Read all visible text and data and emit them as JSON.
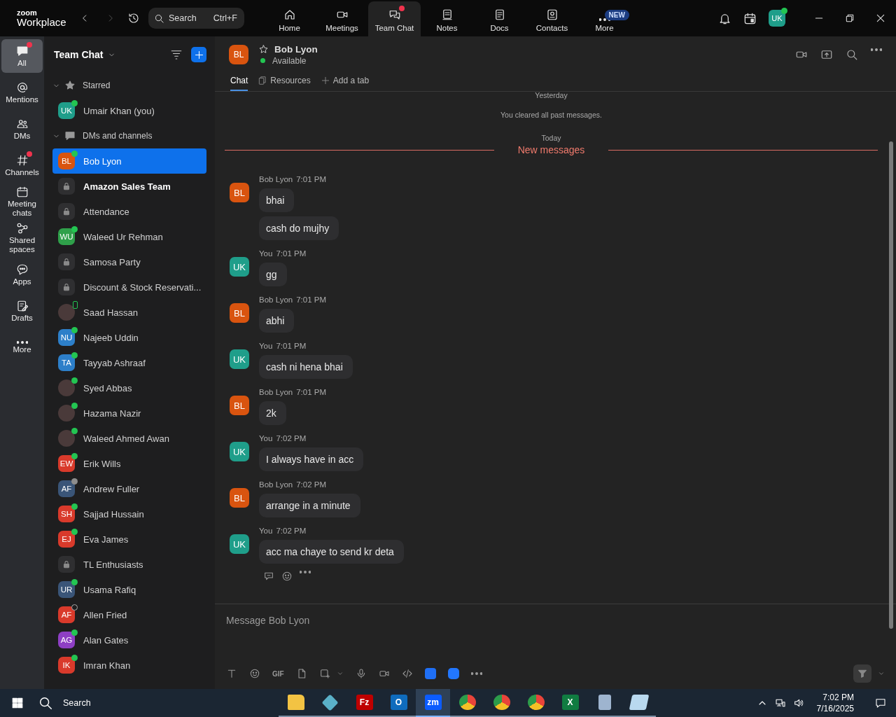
{
  "app": {
    "logo_top": "zoom",
    "logo_bottom": "Workplace",
    "search": {
      "placeholder": "Search",
      "shortcut": "Ctrl+F"
    }
  },
  "nav_tabs": [
    {
      "label": "Home",
      "selected": false,
      "badge_dot": false
    },
    {
      "label": "Meetings",
      "selected": false,
      "badge_dot": false
    },
    {
      "label": "Team Chat",
      "selected": true,
      "badge_dot": true
    },
    {
      "label": "Notes",
      "selected": false,
      "badge_dot": false
    },
    {
      "label": "Docs",
      "selected": false,
      "badge_dot": false
    },
    {
      "label": "Contacts",
      "selected": false,
      "badge_dot": false
    },
    {
      "label": "More",
      "selected": false,
      "badge_dot": false,
      "badge": "NEW"
    }
  ],
  "user": {
    "initials": "UK",
    "color": "#1f9e8a",
    "presence": {
      "kind": "online"
    }
  },
  "rail": [
    {
      "label": "All",
      "selected": true,
      "badge_dot": true
    },
    {
      "label": "Mentions",
      "selected": false,
      "badge_dot": false
    },
    {
      "label": "DMs",
      "selected": false,
      "badge_dot": false
    },
    {
      "label": "Channels",
      "selected": false,
      "badge_dot": true
    },
    {
      "label": "Meeting chats",
      "selected": false,
      "badge_dot": false
    },
    {
      "label": "Shared spaces",
      "selected": false,
      "badge_dot": false
    },
    {
      "label": "Apps",
      "selected": false,
      "badge_dot": false
    },
    {
      "label": "Drafts",
      "selected": false,
      "badge_dot": false
    },
    {
      "label": "More",
      "selected": false,
      "badge_dot": false
    }
  ],
  "sidebar": {
    "title": "Team Chat",
    "sections": [
      {
        "title": "Starred",
        "expanded": true,
        "items": [
          {
            "name": "Umair Khan (you)",
            "avatar": {
              "kind": "initials",
              "text": "UK",
              "color": "#1f9e8a"
            },
            "presence": {
              "kind": "online"
            },
            "bold": false,
            "selected": false
          }
        ]
      },
      {
        "title": "DMs and channels",
        "expanded": true,
        "items": [
          {
            "name": "Bob Lyon",
            "avatar": {
              "kind": "initials",
              "text": "BL",
              "color": "#d9540f"
            },
            "presence": {
              "kind": "online"
            },
            "bold": false,
            "selected": true
          },
          {
            "name": "Amazon Sales Team",
            "avatar": {
              "kind": "lock"
            },
            "bold": true,
            "selected": false
          },
          {
            "name": "Attendance",
            "avatar": {
              "kind": "lock"
            },
            "bold": false,
            "selected": false
          },
          {
            "name": "Waleed Ur Rehman",
            "avatar": {
              "kind": "initials",
              "text": "WU",
              "color": "#2fa04a"
            },
            "presence": {
              "kind": "online"
            },
            "bold": false,
            "selected": false
          },
          {
            "name": "Samosa Party",
            "avatar": {
              "kind": "lock"
            },
            "bold": false,
            "selected": false
          },
          {
            "name": "Discount & Stock Reservati...",
            "avatar": {
              "kind": "lock"
            },
            "bold": false,
            "selected": false
          },
          {
            "name": "Saad Hassan",
            "avatar": {
              "kind": "photo"
            },
            "presence": {
              "kind": "mobile"
            },
            "bold": false,
            "selected": false
          },
          {
            "name": "Najeeb Uddin",
            "avatar": {
              "kind": "initials",
              "text": "NU",
              "color": "#2d7fc9"
            },
            "presence": {
              "kind": "online"
            },
            "bold": false,
            "selected": false
          },
          {
            "name": "Tayyab Ashraaf",
            "avatar": {
              "kind": "initials",
              "text": "TA",
              "color": "#2d7fc9"
            },
            "presence": {
              "kind": "online"
            },
            "bold": false,
            "selected": false
          },
          {
            "name": "Syed Abbas",
            "avatar": {
              "kind": "photo"
            },
            "presence": {
              "kind": "online"
            },
            "bold": false,
            "selected": false
          },
          {
            "name": "Hazama Nazir",
            "avatar": {
              "kind": "photo"
            },
            "presence": {
              "kind": "online"
            },
            "bold": false,
            "selected": false
          },
          {
            "name": "Waleed Ahmed Awan",
            "avatar": {
              "kind": "photo"
            },
            "presence": {
              "kind": "online"
            },
            "bold": false,
            "selected": false
          },
          {
            "name": "Erik Wills",
            "avatar": {
              "kind": "initials",
              "text": "EW",
              "color": "#d93a2b"
            },
            "presence": {
              "kind": "online"
            },
            "bold": false,
            "selected": false
          },
          {
            "name": "Andrew Fuller",
            "avatar": {
              "kind": "initials",
              "text": "AF",
              "color": "#3a5578"
            },
            "presence": {
              "kind": "idle"
            },
            "bold": false,
            "selected": false
          },
          {
            "name": "Sajjad Hussain",
            "avatar": {
              "kind": "initials",
              "text": "SH",
              "color": "#d93a2b"
            },
            "presence": {
              "kind": "online"
            },
            "bold": false,
            "selected": false
          },
          {
            "name": "Eva James",
            "avatar": {
              "kind": "initials",
              "text": "EJ",
              "color": "#d93a2b"
            },
            "presence": {
              "kind": "online"
            },
            "bold": false,
            "selected": false
          },
          {
            "name": "TL Enthusiasts",
            "avatar": {
              "kind": "lock"
            },
            "bold": false,
            "selected": false
          },
          {
            "name": "Usama Rafiq",
            "avatar": {
              "kind": "initials",
              "text": "UR",
              "color": "#3a5578"
            },
            "presence": {
              "kind": "online"
            },
            "bold": false,
            "selected": false
          },
          {
            "name": "Allen Fried",
            "avatar": {
              "kind": "initials",
              "text": "AF",
              "color": "#d93a2b"
            },
            "presence": {
              "kind": "offline"
            },
            "bold": false,
            "selected": false
          },
          {
            "name": "Alan Gates",
            "avatar": {
              "kind": "initials",
              "text": "AG",
              "color": "#8e3fc4"
            },
            "presence": {
              "kind": "online"
            },
            "bold": false,
            "selected": false
          },
          {
            "name": "Imran Khan",
            "avatar": {
              "kind": "initials",
              "text": "IK",
              "color": "#d93a2b"
            },
            "presence": {
              "kind": "online"
            },
            "bold": false,
            "selected": false
          }
        ]
      }
    ]
  },
  "chat": {
    "header": {
      "name": "Bob Lyon",
      "status": "Available",
      "presence": {
        "kind": "online"
      },
      "starred": false,
      "avatar": {
        "text": "BL",
        "color": "#d9540f"
      }
    },
    "tabs": [
      {
        "label": "Chat",
        "selected": true
      },
      {
        "label": "Resources",
        "selected": false
      },
      {
        "label": "Add a tab",
        "selected": false
      }
    ],
    "timeline": [
      {
        "kind": "date",
        "text": "Yesterday"
      },
      {
        "kind": "notice",
        "text": "You cleared all past messages."
      },
      {
        "kind": "date",
        "text": "Today"
      },
      {
        "kind": "new_divider",
        "text": "New messages"
      },
      {
        "kind": "group",
        "sender": "Bob Lyon",
        "time": "7:01 PM",
        "avatar": {
          "text": "BL",
          "color": "#d9540f"
        },
        "messages": [
          "bhai",
          "cash do mujhy"
        ]
      },
      {
        "kind": "group",
        "sender": "You",
        "time": "7:01 PM",
        "avatar": {
          "text": "UK",
          "color": "#1f9e8a"
        },
        "messages": [
          "gg"
        ]
      },
      {
        "kind": "group",
        "sender": "Bob Lyon",
        "time": "7:01 PM",
        "avatar": {
          "text": "BL",
          "color": "#d9540f"
        },
        "messages": [
          "abhi"
        ]
      },
      {
        "kind": "group",
        "sender": "You",
        "time": "7:01 PM",
        "avatar": {
          "text": "UK",
          "color": "#1f9e8a"
        },
        "messages": [
          "cash ni hena bhai"
        ]
      },
      {
        "kind": "group",
        "sender": "Bob Lyon",
        "time": "7:01 PM",
        "avatar": {
          "text": "BL",
          "color": "#d9540f"
        },
        "messages": [
          "2k"
        ]
      },
      {
        "kind": "group",
        "sender": "You",
        "time": "7:02 PM",
        "avatar": {
          "text": "UK",
          "color": "#1f9e8a"
        },
        "messages": [
          "I always have in acc"
        ]
      },
      {
        "kind": "group",
        "sender": "Bob Lyon",
        "time": "7:02 PM",
        "avatar": {
          "text": "BL",
          "color": "#d9540f"
        },
        "messages": [
          "arrange in a minute"
        ]
      },
      {
        "kind": "group",
        "sender": "You",
        "time": "7:02 PM",
        "avatar": {
          "text": "UK",
          "color": "#1f9e8a"
        },
        "messages": [
          "acc ma chaye to send kr deta"
        ],
        "actions": true
      }
    ],
    "composer": {
      "placeholder": "Message Bob Lyon",
      "format_label": "GIF"
    }
  },
  "taskbar": {
    "search": "Search",
    "time": "7:02 PM",
    "date": "7/16/2025",
    "apps": [
      {
        "kind": "folder",
        "selected": false
      },
      {
        "kind": "diamond",
        "selected": false
      },
      {
        "kind": "letter",
        "glyph": "Fz",
        "color": "#bf0000",
        "selected": false
      },
      {
        "kind": "letter",
        "glyph": "O",
        "color": "#0f6cbd",
        "selected": false
      },
      {
        "kind": "letter",
        "glyph": "zm",
        "color": "#0b5cff",
        "selected": true
      },
      {
        "kind": "browser",
        "selected": false
      },
      {
        "kind": "browser",
        "selected": false
      },
      {
        "kind": "browser",
        "selected": false
      },
      {
        "kind": "letter",
        "glyph": "X",
        "color": "#107c41",
        "selected": false
      },
      {
        "kind": "calculator",
        "selected": false
      },
      {
        "kind": "notepad",
        "selected": false
      }
    ]
  }
}
